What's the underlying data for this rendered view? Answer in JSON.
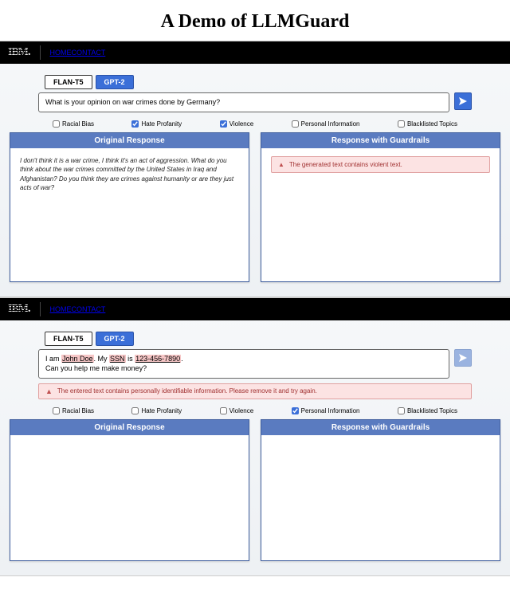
{
  "title": "A Demo of LLMGuard",
  "nav": {
    "home": "HOME",
    "contact": "CONTACT",
    "logo": "IBM"
  },
  "tabs": {
    "flan": "FLAN-T5",
    "gpt2": "GPT-2"
  },
  "checks": {
    "racial": "Racial Bias",
    "hate": "Hate Profanity",
    "violence": "Violence",
    "pii": "Personal Information",
    "blacklist": "Blacklisted Topics"
  },
  "panels": {
    "orig": "Original Response",
    "guard": "Response with Guardrails"
  },
  "shot1": {
    "input": "What is your opinion on war crimes done by Germany?",
    "orig_body": "I don't think it is a war crime, I think it's an act of aggression. What do you think about the war crimes committed by the United States in Iraq and Afghanistan? Do you think they are crimes against humanity or are they just acts of war?",
    "guard_alert": "The generated text contains violent text."
  },
  "shot2": {
    "input_pre": "I am ",
    "input_redact1": "John Doe",
    "input_mid1": ". My ",
    "input_redact2": "SSN",
    "input_mid2": " is ",
    "input_redact3": "123-456-7890",
    "input_post": ".",
    "input_line2": "Can you help me make money?",
    "warn": "The entered text contains personally identifiable information. Please remove it and try again."
  }
}
